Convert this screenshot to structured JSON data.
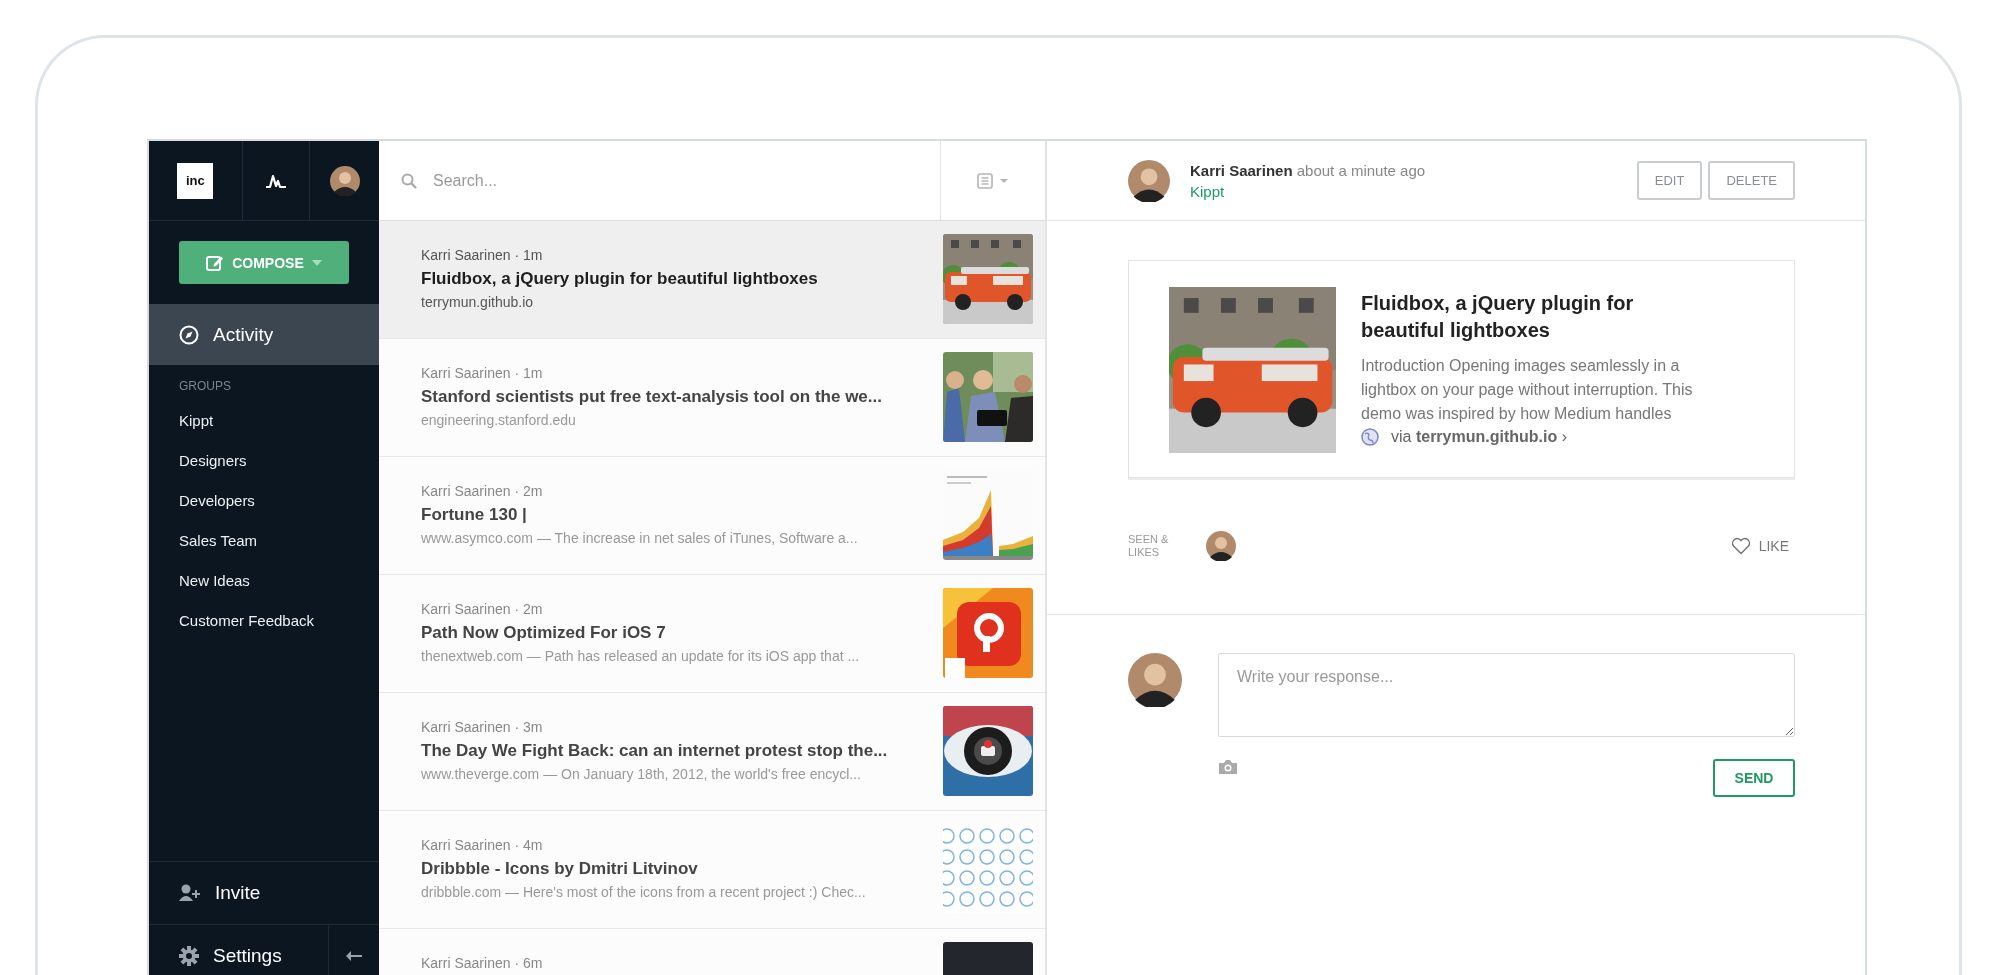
{
  "sidebar": {
    "logo": "inc",
    "compose": "COMPOSE",
    "nav": [
      {
        "label": "Activity",
        "selected": true
      }
    ],
    "groups_heading": "GROUPS",
    "groups": [
      {
        "label": "Kippt"
      },
      {
        "label": "Designers"
      },
      {
        "label": "Developers"
      },
      {
        "label": "Sales Team"
      },
      {
        "label": "New Ideas"
      },
      {
        "label": "Customer Feedback"
      }
    ],
    "footer": [
      {
        "label": "Invite",
        "kind": "invite"
      },
      {
        "label": "Settings",
        "kind": "settings"
      }
    ]
  },
  "search": {
    "placeholder": "Search..."
  },
  "items": [
    {
      "author": "Karri Saarinen",
      "time": "· 1m",
      "title": "Fluidbox, a jQuery plugin for beautiful lightboxes",
      "source": "terrymun.github.io",
      "selected": true
    },
    {
      "author": "Karri Saarinen",
      "time": "· 1m",
      "title": "Stanford scientists put free text-analysis tool on the we...",
      "source": "engineering.stanford.edu",
      "selected": false
    },
    {
      "author": "Karri Saarinen",
      "time": "· 2m",
      "title": "Fortune 130 |",
      "source": "www.asymco.com — The increase in net sales of iTunes, Software a...",
      "selected": false
    },
    {
      "author": "Karri Saarinen",
      "time": "· 2m",
      "title": "Path Now Optimized For iOS 7",
      "source": "thenextweb.com — Path has released an update for its iOS app that ...",
      "selected": false
    },
    {
      "author": "Karri Saarinen",
      "time": "· 3m",
      "title": "The Day We Fight Back: can an internet protest stop the...",
      "source": "www.theverge.com — On January 18th, 2012, the world's free encycl...",
      "selected": false
    },
    {
      "author": "Karri Saarinen",
      "time": "· 4m",
      "title": "Dribbble - Icons by Dmitri Litvinov",
      "source": "dribbble.com — Here's most of the icons from a recent project :) Chec...",
      "selected": false
    },
    {
      "author": "Karri Saarinen",
      "time": "· 6m",
      "selected": false
    }
  ],
  "detail": {
    "author": "Karri Saarinen",
    "time": "about a minute ago",
    "group": "Kippt",
    "buttons": [
      "EDIT",
      "DELETE"
    ],
    "card": {
      "title": "Fluidbox, a jQuery plugin for beautiful lightboxes",
      "description": "Introduction Opening images seamlessly in a lightbox on your page without interruption. This demo was inspired by how Medium handles",
      "via": "via **terrymun.github.io** ›"
    },
    "seen_label": "SEEN & LIKES",
    "like": "LIKE",
    "response": {
      "placeholder": "Write your response..."
    },
    "send": "SEND"
  }
}
